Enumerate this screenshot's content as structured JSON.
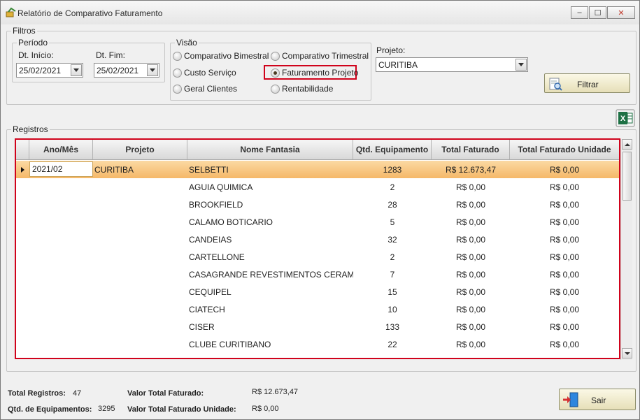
{
  "window": {
    "title": "Relatório de Comparativo Faturamento",
    "buttons": {
      "minimize": "‒",
      "maximize": "☐",
      "close": "✕"
    }
  },
  "filtros": {
    "legend": "Filtros",
    "periodo": {
      "legend": "Período",
      "dt_inicio_label": "Dt. Início:",
      "dt_inicio_value": "25/02/2021",
      "dt_fim_label": "Dt. Fim:",
      "dt_fim_value": "25/02/2021"
    },
    "visao": {
      "legend": "Visão",
      "options": [
        {
          "label": "Comparativo Bimestral",
          "checked": false
        },
        {
          "label": "Comparativo Trimestral",
          "checked": false
        },
        {
          "label": "Custo Serviço",
          "checked": false
        },
        {
          "label": "Faturamento Projeto",
          "checked": true
        },
        {
          "label": "Geral Clientes",
          "checked": false
        },
        {
          "label": "Rentabilidade",
          "checked": false
        }
      ]
    },
    "projeto": {
      "label": "Projeto:",
      "value": "CURITIBA"
    },
    "filtrar_label": "Filtrar"
  },
  "registros": {
    "legend": "Registros",
    "columns": [
      "Ano/Mês",
      "Projeto",
      "Nome Fantasia",
      "Qtd. Equipamento",
      "Total Faturado",
      "Total Faturado Unidade"
    ],
    "rows": [
      {
        "ano_mes": "2021/02",
        "projeto": "CURITIBA",
        "nome": "SELBETTI",
        "qtd": "1283",
        "total": "R$ 12.673,47",
        "unidade": "R$ 0,00"
      },
      {
        "ano_mes": "",
        "projeto": "",
        "nome": "AGUIA QUIMICA",
        "qtd": "2",
        "total": "R$ 0,00",
        "unidade": "R$ 0,00"
      },
      {
        "ano_mes": "",
        "projeto": "",
        "nome": "BROOKFIELD",
        "qtd": "28",
        "total": "R$ 0,00",
        "unidade": "R$ 0,00"
      },
      {
        "ano_mes": "",
        "projeto": "",
        "nome": "CALAMO BOTICARIO",
        "qtd": "5",
        "total": "R$ 0,00",
        "unidade": "R$ 0,00"
      },
      {
        "ano_mes": "",
        "projeto": "",
        "nome": "CANDEIAS",
        "qtd": "32",
        "total": "R$ 0,00",
        "unidade": "R$ 0,00"
      },
      {
        "ano_mes": "",
        "projeto": "",
        "nome": "CARTELLONE",
        "qtd": "2",
        "total": "R$ 0,00",
        "unidade": "R$ 0,00"
      },
      {
        "ano_mes": "",
        "projeto": "",
        "nome": "CASAGRANDE  REVESTIMENTOS  CERAMI...",
        "qtd": "7",
        "total": "R$ 0,00",
        "unidade": "R$ 0,00"
      },
      {
        "ano_mes": "",
        "projeto": "",
        "nome": "CEQUIPEL",
        "qtd": "15",
        "total": "R$ 0,00",
        "unidade": "R$ 0,00"
      },
      {
        "ano_mes": "",
        "projeto": "",
        "nome": "CIATECH",
        "qtd": "10",
        "total": "R$ 0,00",
        "unidade": "R$ 0,00"
      },
      {
        "ano_mes": "",
        "projeto": "",
        "nome": "CISER",
        "qtd": "133",
        "total": "R$ 0,00",
        "unidade": "R$ 0,00"
      },
      {
        "ano_mes": "",
        "projeto": "",
        "nome": "CLUBE CURITIBANO",
        "qtd": "22",
        "total": "R$ 0,00",
        "unidade": "R$ 0,00"
      }
    ]
  },
  "summary": {
    "total_registros_label": "Total Registros:",
    "total_registros_value": "47",
    "qtd_equip_label": "Qtd. de Equipamentos:",
    "qtd_equip_value": "3295",
    "valor_total_label": "Valor Total Faturado:",
    "valor_total_value": "R$ 12.673,47",
    "valor_unidade_label": "Valor Total Faturado Unidade:",
    "valor_unidade_value": "R$ 0,00"
  },
  "sair_label": "Sair"
}
